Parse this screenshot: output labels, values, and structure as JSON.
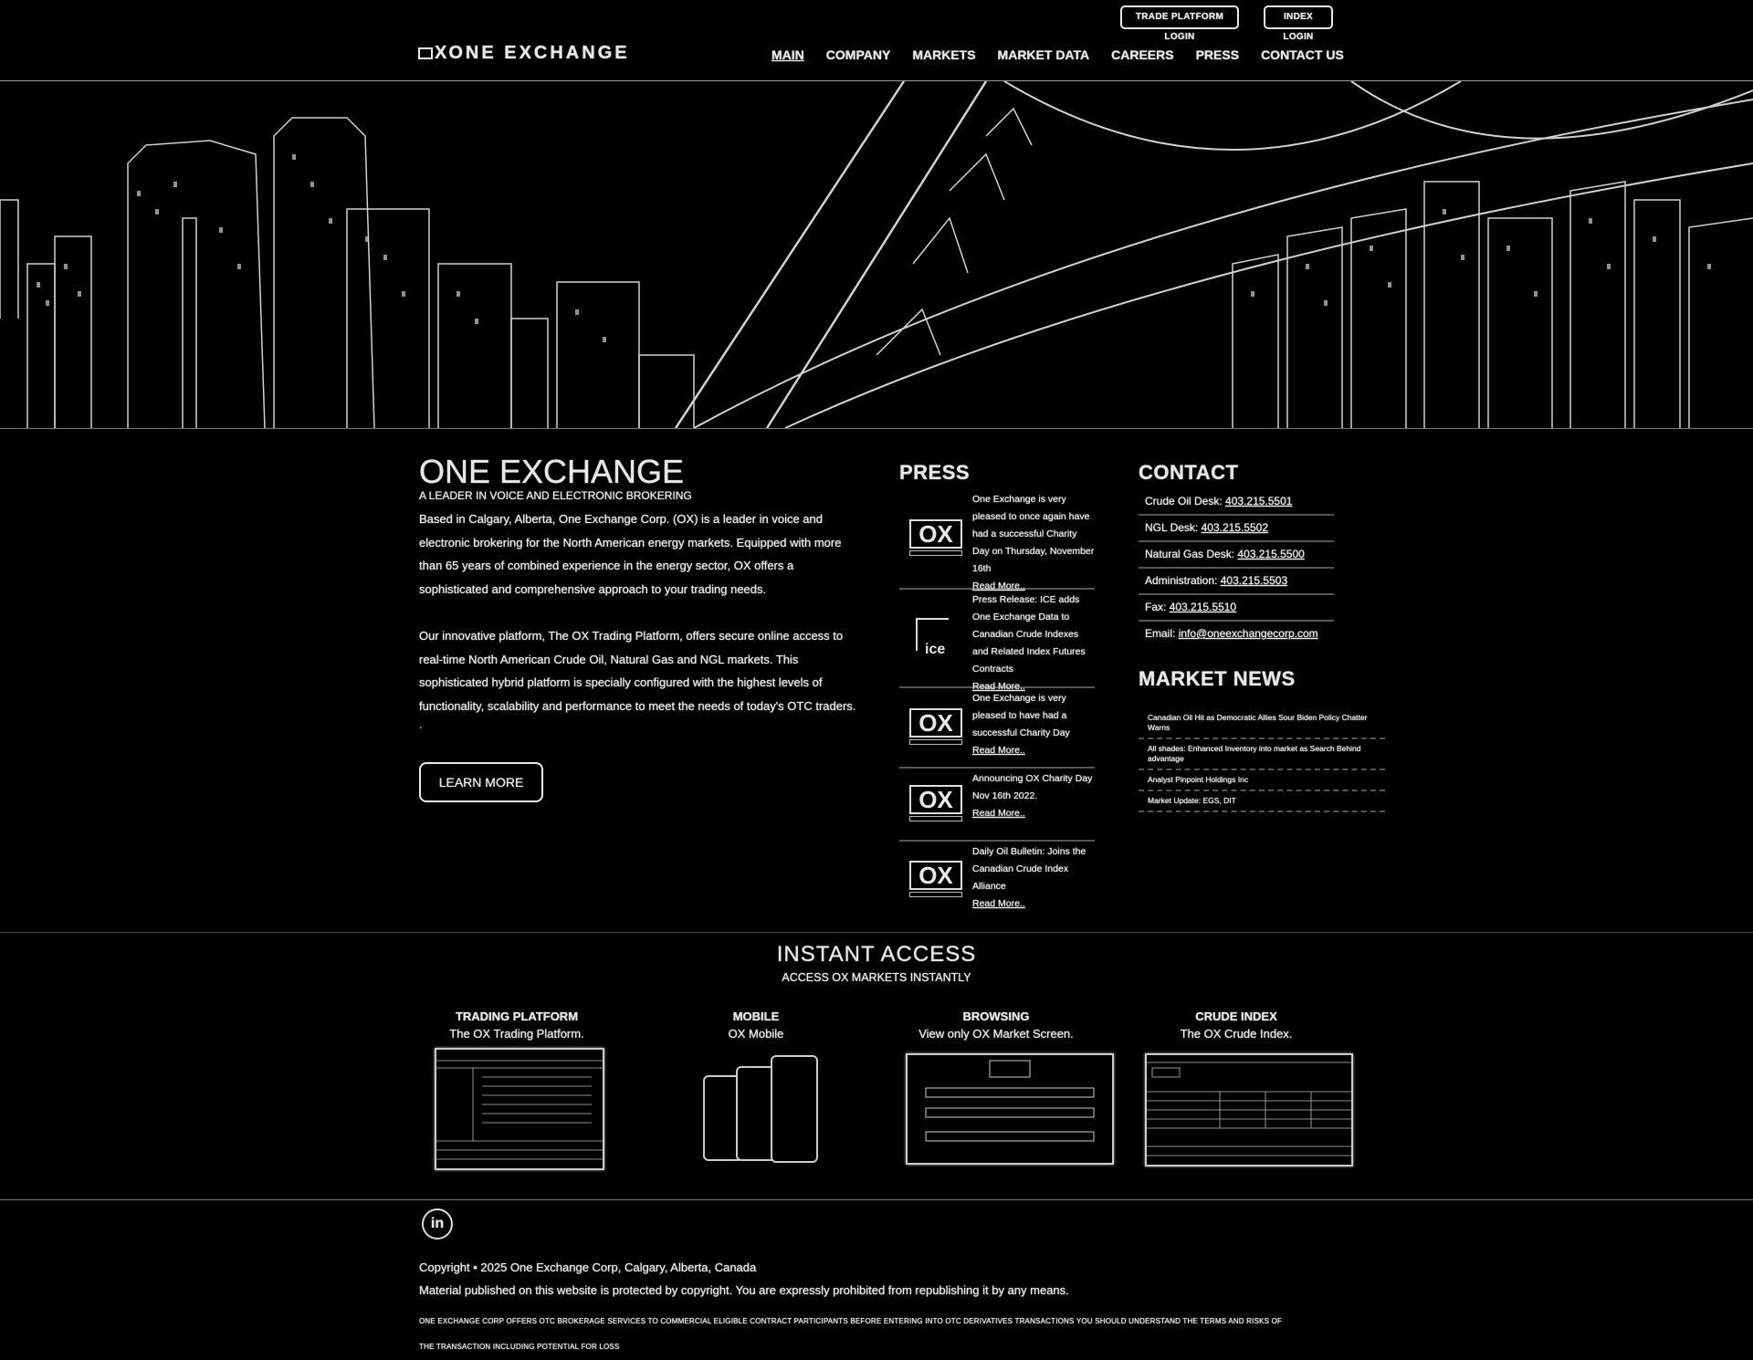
{
  "header": {
    "top_buttons": [
      "TRADE PLATFORM LOGIN",
      "INDEX LOGIN"
    ],
    "logo_mark": "X",
    "logo_text": "ONE EXCHANGE",
    "nav": [
      "MAIN",
      "COMPANY",
      "MARKETS",
      "MARKET DATA",
      "CAREERS",
      "PRESS",
      "CONTACT US"
    ]
  },
  "intro": {
    "title": "ONE EXCHANGE",
    "subtitle": "A LEADER IN VOICE AND ELECTRONIC BROKERING",
    "para1": "Based in Calgary, Alberta, One Exchange Corp. (OX) is a leader in voice and electronic brokering for the North American energy markets. Equipped with more than 65 years of combined experience in the energy sector, OX offers a sophisticated and comprehensive approach to your trading needs.",
    "para2": "Our innovative platform, The OX Trading Platform, offers secure online access to real-time North American Crude Oil, Natural Gas and NGL markets. This sophisticated hybrid platform is specially configured with the highest levels of functionality, scalability and performance to meet the needs of today's OTC traders.",
    "dot": ".",
    "learn_more": "LEARN MORE"
  },
  "press": {
    "title": "PRESS",
    "items": [
      {
        "text": "One Exchange is very pleased to once again have had a successful Charity Day on Thursday, November 16th",
        "more": "Read More..",
        "logo": "OX"
      },
      {
        "text": "Press Release: ICE adds One Exchange Data to Canadian Crude Indexes and Related Index Futures Contracts",
        "more": "Read More..",
        "logo": "ICE"
      },
      {
        "text": "One Exchange is very pleased to have had a successful Charity Day",
        "more": "Read More..",
        "logo": "OX"
      },
      {
        "text": "Announcing OX Charity Day Nov 16th 2022.",
        "more": "Read More..",
        "logo": "OX"
      },
      {
        "text": "Daily Oil Bulletin: Joins the Canadian Crude Index Alliance",
        "more": "Read More..",
        "logo": "OX"
      }
    ],
    "logo_small": "ONE EXCHANGE",
    "ice_label": "ice"
  },
  "contact": {
    "title": "CONTACT",
    "rows": [
      {
        "label": "Crude Oil Desk:",
        "value": "403.215.5501"
      },
      {
        "label": "NGL Desk:",
        "value": "403.215.5502"
      },
      {
        "label": "Natural Gas Desk:",
        "value": "403.215.5500"
      },
      {
        "label": "Administration:",
        "value": "403.215.5503"
      },
      {
        "label": "Fax:",
        "value": "403.215.5510"
      },
      {
        "label": "Email:",
        "value": "info@oneexchangecorp.com"
      }
    ]
  },
  "news": {
    "title": "MARKET NEWS",
    "items": [
      "Canadian Oil Hit as Democratic Allies Sour Biden Policy Chatter Warns",
      "All shades: Enhanced Inventory into market as Search Behind advantage",
      "Analyst Pinpoint Holdings Inc",
      "Market Update: EGS, DIT"
    ]
  },
  "instant": {
    "title": "INSTANT ACCESS",
    "subtitle": "ACCESS OX MARKETS INSTANTLY",
    "cards": [
      {
        "title": "TRADING PLATFORM",
        "desc": "The OX Trading Platform."
      },
      {
        "title": "MOBILE",
        "desc": "OX Mobile"
      },
      {
        "title": "BROWSING",
        "desc": "View only OX Market Screen."
      },
      {
        "title": "CRUDE INDEX",
        "desc": "The OX Crude Index."
      }
    ]
  },
  "footer": {
    "linkedin": "in",
    "copyright": "Copyright • 2025 One Exchange Corp, Calgary, Alberta, Canada",
    "material": "Material published on this website is protected by copyright. You are expressly prohibited from republishing it by any means.",
    "disclaimer": "ONE EXCHANGE CORP OFFERS OTC BROKERAGE SERVICES TO COMMERCIAL ELIGIBLE CONTRACT PARTICIPANTS BEFORE ENTERING INTO OTC DERIVATIVES TRANSACTIONS YOU SHOULD UNDERSTAND THE TERMS AND RISKS OF THE TRANSACTION INCLUDING POTENTIAL FOR LOSS"
  },
  "colors": {
    "background": "#000000",
    "foreground": "#e8e8e8",
    "divider": "#555555"
  }
}
